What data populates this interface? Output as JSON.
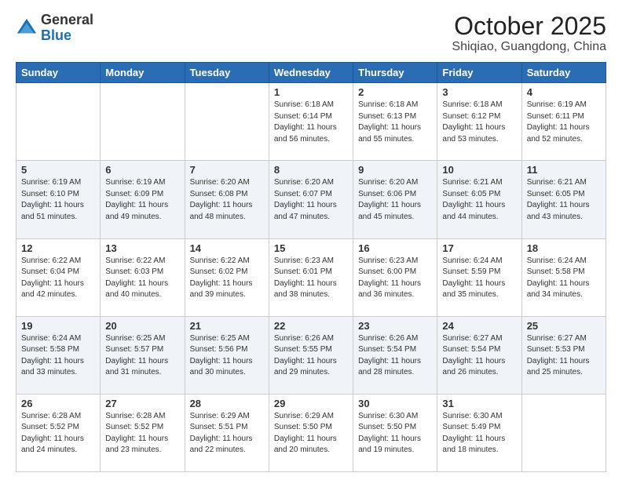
{
  "header": {
    "logo_general": "General",
    "logo_blue": "Blue",
    "month": "October 2025",
    "location": "Shiqiao, Guangdong, China"
  },
  "days_of_week": [
    "Sunday",
    "Monday",
    "Tuesday",
    "Wednesday",
    "Thursday",
    "Friday",
    "Saturday"
  ],
  "weeks": [
    [
      {
        "day": "",
        "text": ""
      },
      {
        "day": "",
        "text": ""
      },
      {
        "day": "",
        "text": ""
      },
      {
        "day": "1",
        "text": "Sunrise: 6:18 AM\nSunset: 6:14 PM\nDaylight: 11 hours\nand 56 minutes."
      },
      {
        "day": "2",
        "text": "Sunrise: 6:18 AM\nSunset: 6:13 PM\nDaylight: 11 hours\nand 55 minutes."
      },
      {
        "day": "3",
        "text": "Sunrise: 6:18 AM\nSunset: 6:12 PM\nDaylight: 11 hours\nand 53 minutes."
      },
      {
        "day": "4",
        "text": "Sunrise: 6:19 AM\nSunset: 6:11 PM\nDaylight: 11 hours\nand 52 minutes."
      }
    ],
    [
      {
        "day": "5",
        "text": "Sunrise: 6:19 AM\nSunset: 6:10 PM\nDaylight: 11 hours\nand 51 minutes."
      },
      {
        "day": "6",
        "text": "Sunrise: 6:19 AM\nSunset: 6:09 PM\nDaylight: 11 hours\nand 49 minutes."
      },
      {
        "day": "7",
        "text": "Sunrise: 6:20 AM\nSunset: 6:08 PM\nDaylight: 11 hours\nand 48 minutes."
      },
      {
        "day": "8",
        "text": "Sunrise: 6:20 AM\nSunset: 6:07 PM\nDaylight: 11 hours\nand 47 minutes."
      },
      {
        "day": "9",
        "text": "Sunrise: 6:20 AM\nSunset: 6:06 PM\nDaylight: 11 hours\nand 45 minutes."
      },
      {
        "day": "10",
        "text": "Sunrise: 6:21 AM\nSunset: 6:05 PM\nDaylight: 11 hours\nand 44 minutes."
      },
      {
        "day": "11",
        "text": "Sunrise: 6:21 AM\nSunset: 6:05 PM\nDaylight: 11 hours\nand 43 minutes."
      }
    ],
    [
      {
        "day": "12",
        "text": "Sunrise: 6:22 AM\nSunset: 6:04 PM\nDaylight: 11 hours\nand 42 minutes."
      },
      {
        "day": "13",
        "text": "Sunrise: 6:22 AM\nSunset: 6:03 PM\nDaylight: 11 hours\nand 40 minutes."
      },
      {
        "day": "14",
        "text": "Sunrise: 6:22 AM\nSunset: 6:02 PM\nDaylight: 11 hours\nand 39 minutes."
      },
      {
        "day": "15",
        "text": "Sunrise: 6:23 AM\nSunset: 6:01 PM\nDaylight: 11 hours\nand 38 minutes."
      },
      {
        "day": "16",
        "text": "Sunrise: 6:23 AM\nSunset: 6:00 PM\nDaylight: 11 hours\nand 36 minutes."
      },
      {
        "day": "17",
        "text": "Sunrise: 6:24 AM\nSunset: 5:59 PM\nDaylight: 11 hours\nand 35 minutes."
      },
      {
        "day": "18",
        "text": "Sunrise: 6:24 AM\nSunset: 5:58 PM\nDaylight: 11 hours\nand 34 minutes."
      }
    ],
    [
      {
        "day": "19",
        "text": "Sunrise: 6:24 AM\nSunset: 5:58 PM\nDaylight: 11 hours\nand 33 minutes."
      },
      {
        "day": "20",
        "text": "Sunrise: 6:25 AM\nSunset: 5:57 PM\nDaylight: 11 hours\nand 31 minutes."
      },
      {
        "day": "21",
        "text": "Sunrise: 6:25 AM\nSunset: 5:56 PM\nDaylight: 11 hours\nand 30 minutes."
      },
      {
        "day": "22",
        "text": "Sunrise: 6:26 AM\nSunset: 5:55 PM\nDaylight: 11 hours\nand 29 minutes."
      },
      {
        "day": "23",
        "text": "Sunrise: 6:26 AM\nSunset: 5:54 PM\nDaylight: 11 hours\nand 28 minutes."
      },
      {
        "day": "24",
        "text": "Sunrise: 6:27 AM\nSunset: 5:54 PM\nDaylight: 11 hours\nand 26 minutes."
      },
      {
        "day": "25",
        "text": "Sunrise: 6:27 AM\nSunset: 5:53 PM\nDaylight: 11 hours\nand 25 minutes."
      }
    ],
    [
      {
        "day": "26",
        "text": "Sunrise: 6:28 AM\nSunset: 5:52 PM\nDaylight: 11 hours\nand 24 minutes."
      },
      {
        "day": "27",
        "text": "Sunrise: 6:28 AM\nSunset: 5:52 PM\nDaylight: 11 hours\nand 23 minutes."
      },
      {
        "day": "28",
        "text": "Sunrise: 6:29 AM\nSunset: 5:51 PM\nDaylight: 11 hours\nand 22 minutes."
      },
      {
        "day": "29",
        "text": "Sunrise: 6:29 AM\nSunset: 5:50 PM\nDaylight: 11 hours\nand 20 minutes."
      },
      {
        "day": "30",
        "text": "Sunrise: 6:30 AM\nSunset: 5:50 PM\nDaylight: 11 hours\nand 19 minutes."
      },
      {
        "day": "31",
        "text": "Sunrise: 6:30 AM\nSunset: 5:49 PM\nDaylight: 11 hours\nand 18 minutes."
      },
      {
        "day": "",
        "text": ""
      }
    ]
  ]
}
